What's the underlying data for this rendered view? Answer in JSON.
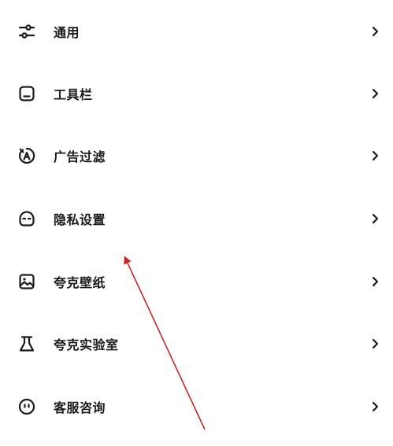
{
  "menu": {
    "items": [
      {
        "label": "通用",
        "icon": "sliders-icon"
      },
      {
        "label": "工具栏",
        "icon": "toolbar-icon"
      },
      {
        "label": "广告过滤",
        "icon": "ad-block-icon"
      },
      {
        "label": "隐私设置",
        "icon": "privacy-mask-icon"
      },
      {
        "label": "夸克壁纸",
        "icon": "wallpaper-icon"
      },
      {
        "label": "夸克实验室",
        "icon": "flask-icon"
      },
      {
        "label": "客服咨询",
        "icon": "support-face-icon"
      }
    ]
  },
  "colors": {
    "text": "#1a1a1a",
    "annotation_arrow": "#c62828",
    "background": "#ffffff"
  }
}
